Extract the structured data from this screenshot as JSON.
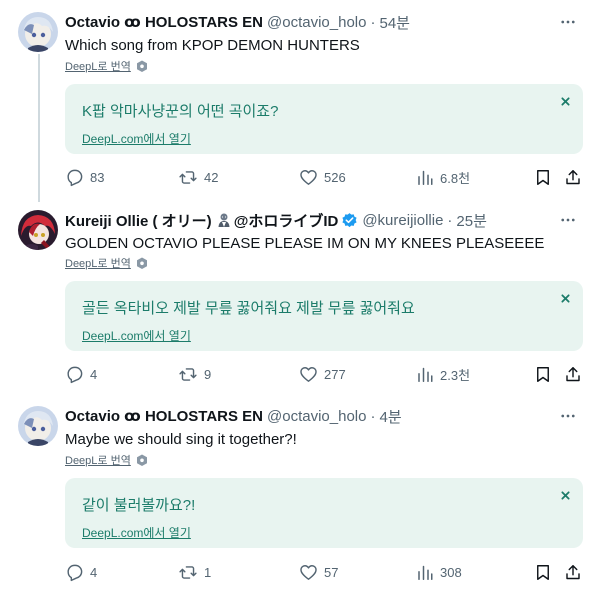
{
  "colors": {
    "text": "#0f1419",
    "muted": "#536471",
    "verified": "#1d9bf0",
    "translate_bg": "#e8f4f0",
    "translate_text": "#1c7c6a",
    "thread_line": "#cfd9de"
  },
  "tweets": [
    {
      "name": "Octavio ꝏ HOLOSTARS EN",
      "handle": "@octavio_holo",
      "dot": "·",
      "time": "54분",
      "text": "Which song from KPOP DEMON HUNTERS",
      "deepl_label": "DeepL로 번역",
      "translation": "K팝 악마사냥꾼의 어떤 곡이죠?",
      "translation_link": "DeepL.com에서 열기",
      "stats": {
        "replies": "83",
        "reposts": "42",
        "likes": "526",
        "views": "6.8천"
      }
    },
    {
      "name": "Kureiji Ollie ( オリー)",
      "name_suffix": "@ホロライブID",
      "handle": "@kureijiollie",
      "dot": "·",
      "time": "25분",
      "text": "GOLDEN OCTAVIO PLEASE PLEASE IM ON MY KNEES PLEASEEEE",
      "deepl_label": "DeepL로 번역",
      "translation": "골든 옥타비오 제발 무릎 꿇어줘요 제발 무릎 꿇어줘요",
      "translation_link": "DeepL.com에서 열기",
      "stats": {
        "replies": "4",
        "reposts": "9",
        "likes": "277",
        "views": "2.3천"
      }
    },
    {
      "name": "Octavio ꝏ HOLOSTARS EN",
      "handle": "@octavio_holo",
      "dot": "·",
      "time": "4분",
      "text": "Maybe we should sing it together?!",
      "deepl_label": "DeepL로 번역",
      "translation": "같이 불러볼까요?!",
      "translation_link": "DeepL.com에서 열기",
      "stats": {
        "replies": "4",
        "reposts": "1",
        "likes": "57",
        "views": "308"
      }
    }
  ],
  "icons": {
    "reply": "reply-icon",
    "repost": "repost-icon",
    "like": "heart-icon",
    "views": "views-icon",
    "bookmark": "bookmark-icon",
    "share": "share-icon",
    "more": "more-icon",
    "verified": "verified-badge-icon",
    "deepl": "deepl-icon",
    "close": "close-icon"
  }
}
